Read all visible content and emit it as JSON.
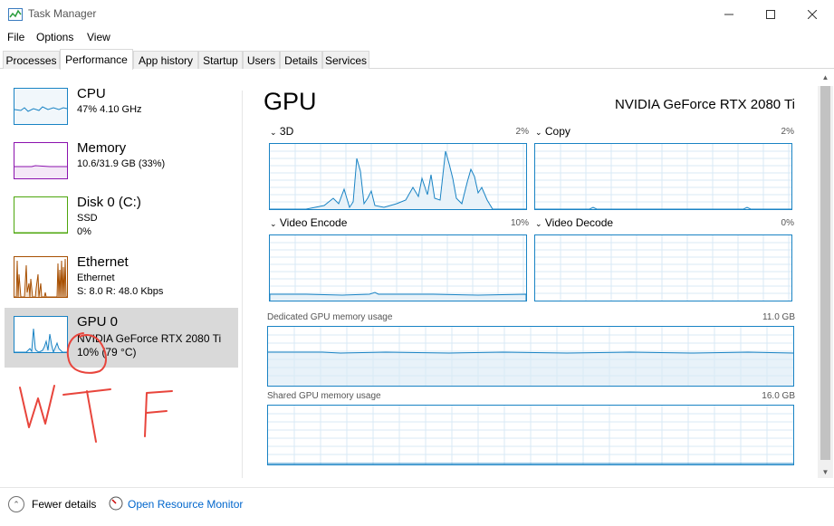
{
  "window": {
    "title": "Task Manager",
    "minimize_glyph": "—",
    "maximize_glyph": "☐",
    "close_glyph": "✕"
  },
  "menu": [
    "File",
    "Options",
    "View"
  ],
  "tabs": [
    "Processes",
    "Performance",
    "App history",
    "Startup",
    "Users",
    "Details",
    "Services"
  ],
  "active_tab": "Performance",
  "sidebar": {
    "items": [
      {
        "title": "CPU",
        "lines": [
          "47% 4.10 GHz"
        ],
        "color": "#1983c4"
      },
      {
        "title": "Memory",
        "lines": [
          "10.6/31.9 GB (33%)"
        ],
        "color": "#8b12ae"
      },
      {
        "title": "Disk 0 (C:)",
        "lines": [
          "SSD",
          "0%"
        ],
        "color": "#4da60c"
      },
      {
        "title": "Ethernet",
        "lines": [
          "Ethernet",
          "S: 8.0  R: 48.0 Kbps"
        ],
        "color": "#a74f01"
      },
      {
        "title": "GPU 0",
        "lines": [
          "NVIDIA GeForce RTX 2080 Ti",
          "10% (79 °C)"
        ],
        "color": "#1983c4"
      }
    ],
    "selected_index": 4
  },
  "main": {
    "title": "GPU",
    "device_name": "NVIDIA GeForce RTX 2080 Ti",
    "engines": [
      {
        "label": "3D",
        "percent": "2%"
      },
      {
        "label": "Copy",
        "percent": "2%"
      },
      {
        "label": "Video Encode",
        "percent": "10%"
      },
      {
        "label": "Video Decode",
        "percent": "0%"
      }
    ],
    "dedicated": {
      "label": "Dedicated GPU memory usage",
      "total": "11.0 GB"
    },
    "shared": {
      "label": "Shared GPU memory usage",
      "total": "16.0 GB"
    },
    "accent_color": "#1983c4"
  },
  "footer": {
    "fewer_details": "Fewer details",
    "resource_monitor": "Open Resource Monitor"
  },
  "annotation": {
    "text": "WTF",
    "color": "#e8453c"
  }
}
